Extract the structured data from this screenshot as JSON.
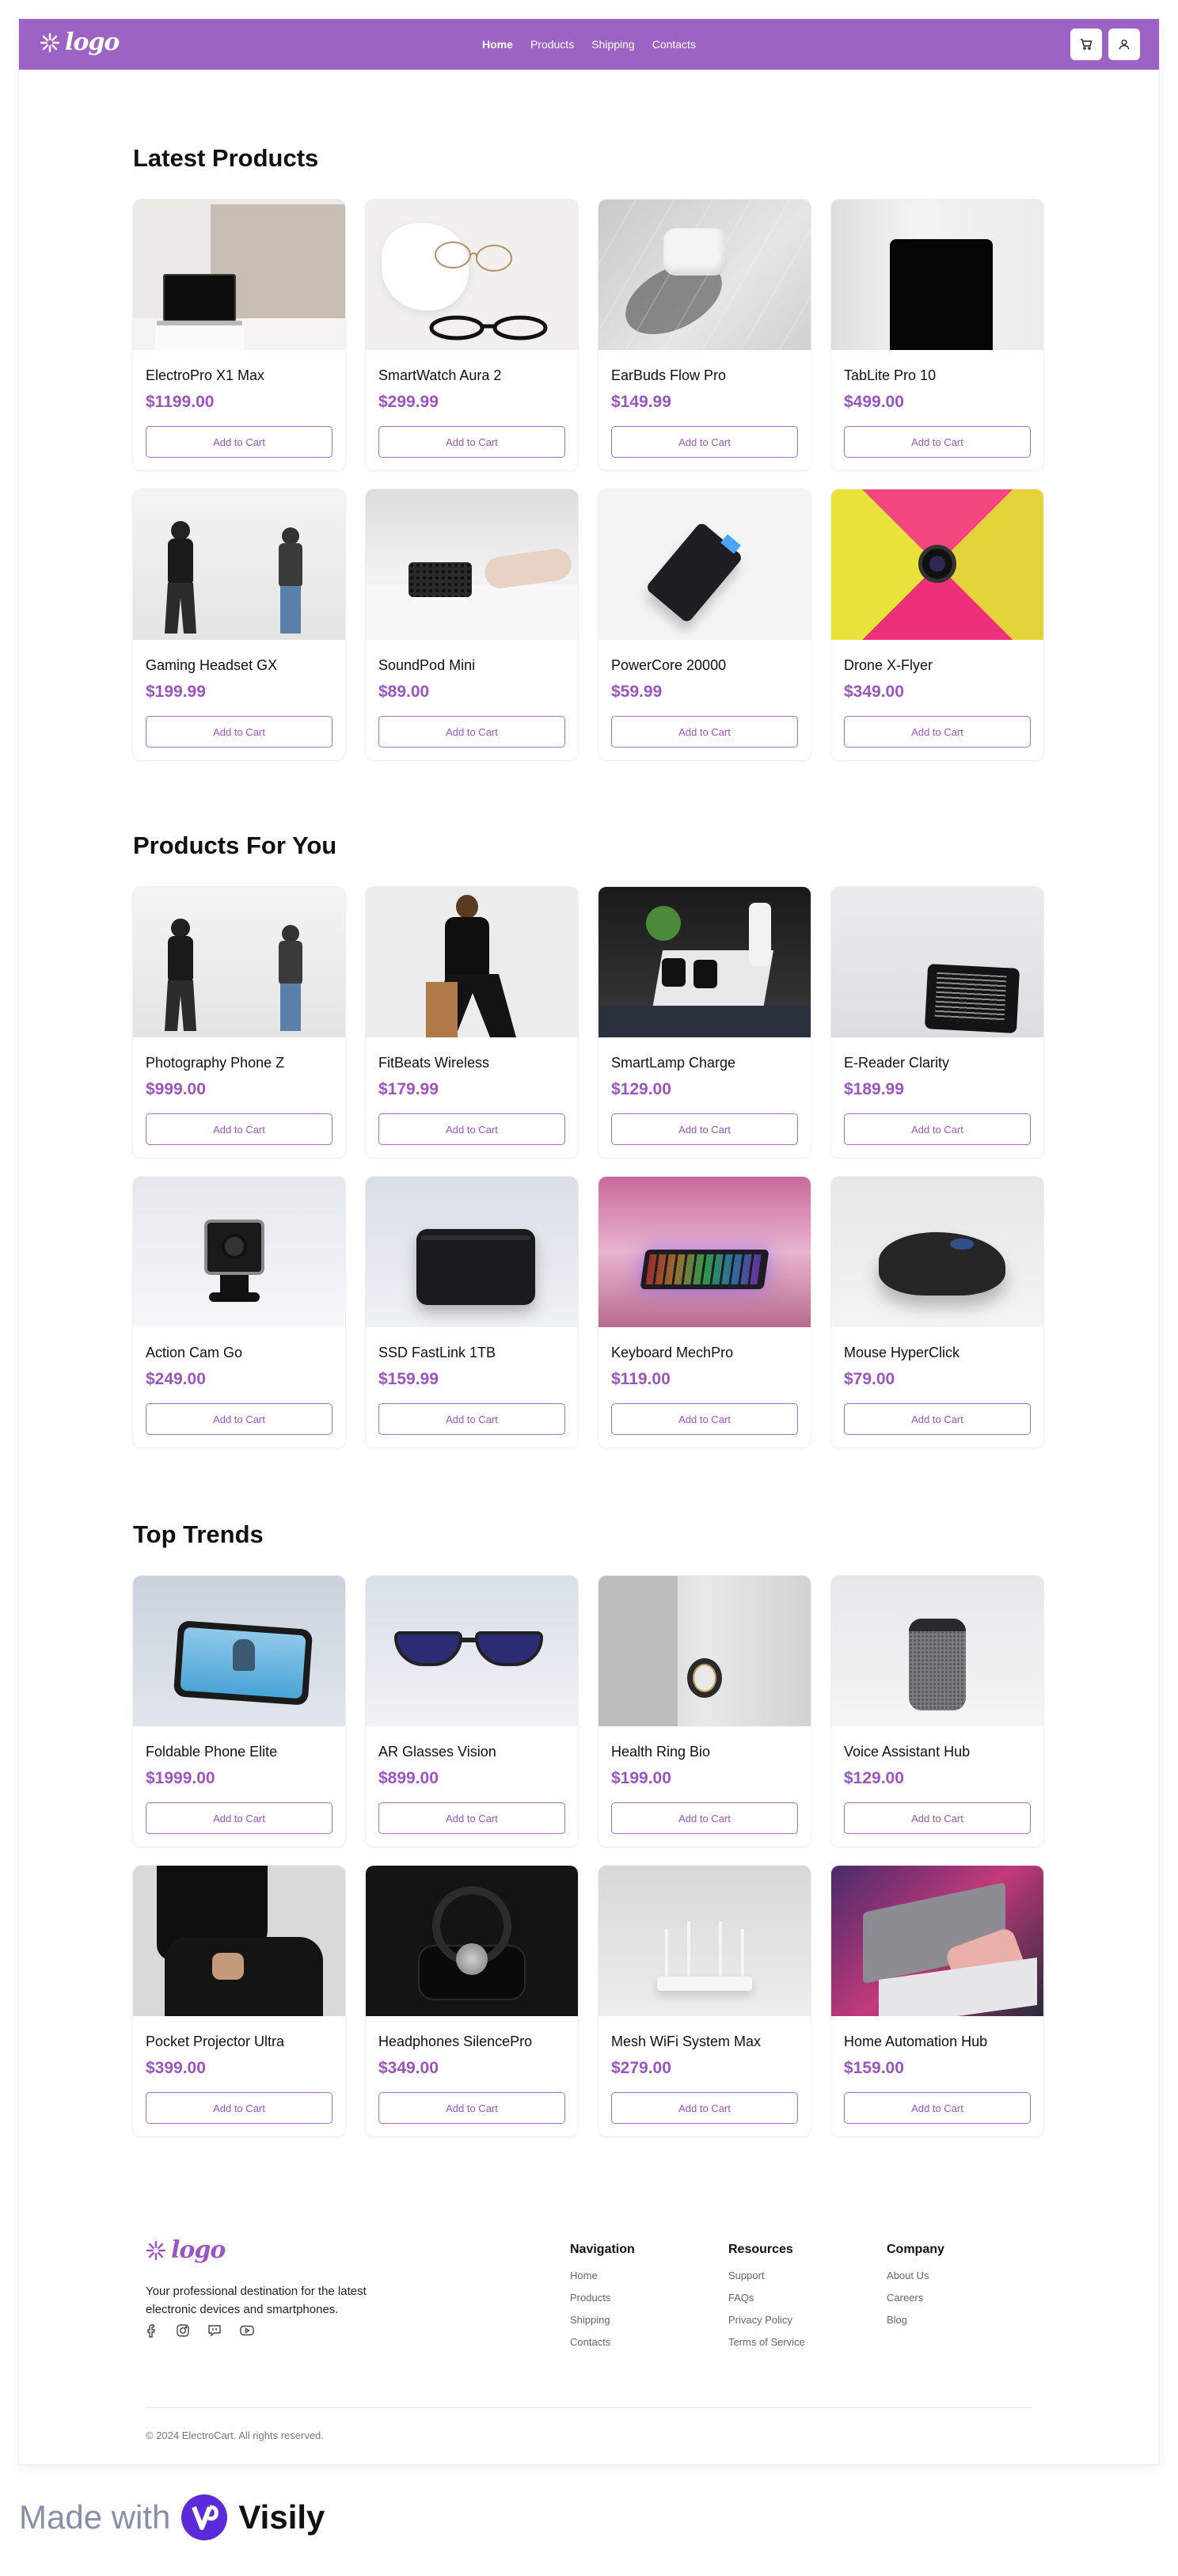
{
  "header": {
    "logo_text": "logo",
    "nav": [
      "Home",
      "Products",
      "Shipping",
      "Contacts"
    ],
    "active_nav": "Home",
    "cart_icon": "cart-icon",
    "user_icon": "user-icon",
    "bg_color": "#9c63c4"
  },
  "sections": [
    {
      "title": "Latest Products",
      "products": [
        {
          "name": "ElectroPro X1 Max",
          "price": "$1199.00",
          "button": "Add to Cart"
        },
        {
          "name": "SmartWatch Aura 2",
          "price": "$299.99",
          "button": "Add to Cart"
        },
        {
          "name": "EarBuds Flow Pro",
          "price": "$149.99",
          "button": "Add to Cart"
        },
        {
          "name": "TabLite Pro 10",
          "price": "$499.00",
          "button": "Add to Cart"
        },
        {
          "name": "Gaming Headset GX",
          "price": "$199.99",
          "button": "Add to Cart"
        },
        {
          "name": "SoundPod Mini",
          "price": "$89.00",
          "button": "Add to Cart"
        },
        {
          "name": "PowerCore 20000",
          "price": "$59.99",
          "button": "Add to Cart"
        },
        {
          "name": "Drone X-Flyer",
          "price": "$349.00",
          "button": "Add to Cart"
        }
      ]
    },
    {
      "title": "Products For You",
      "products": [
        {
          "name": "Photography Phone Z",
          "price": "$999.00",
          "button": "Add to Cart"
        },
        {
          "name": "FitBeats Wireless",
          "price": "$179.99",
          "button": "Add to Cart"
        },
        {
          "name": "SmartLamp Charge",
          "price": "$129.00",
          "button": "Add to Cart"
        },
        {
          "name": "E-Reader Clarity",
          "price": "$189.99",
          "button": "Add to Cart"
        },
        {
          "name": "Action Cam Go",
          "price": "$249.00",
          "button": "Add to Cart"
        },
        {
          "name": "SSD FastLink 1TB",
          "price": "$159.99",
          "button": "Add to Cart"
        },
        {
          "name": "Keyboard MechPro",
          "price": "$119.00",
          "button": "Add to Cart"
        },
        {
          "name": "Mouse HyperClick",
          "price": "$79.00",
          "button": "Add to Cart"
        }
      ]
    },
    {
      "title": "Top Trends",
      "products": [
        {
          "name": "Foldable Phone Elite",
          "price": "$1999.00",
          "button": "Add to Cart"
        },
        {
          "name": "AR Glasses Vision",
          "price": "$899.00",
          "button": "Add to Cart"
        },
        {
          "name": "Health Ring Bio",
          "price": "$199.00",
          "button": "Add to Cart"
        },
        {
          "name": "Voice Assistant Hub",
          "price": "$129.00",
          "button": "Add to Cart"
        },
        {
          "name": "Pocket Projector Ultra",
          "price": "$399.00",
          "button": "Add to Cart"
        },
        {
          "name": "Headphones SilencePro",
          "price": "$349.00",
          "button": "Add to Cart"
        },
        {
          "name": "Mesh WiFi System Max",
          "price": "$279.00",
          "button": "Add to Cart"
        },
        {
          "name": "Home Automation Hub",
          "price": "$159.00",
          "button": "Add to Cart"
        }
      ]
    }
  ],
  "footer": {
    "logo_text": "logo",
    "description": "Your professional destination for the latest electronic devices and smartphones.",
    "social_icons": [
      "facebook-icon",
      "instagram-icon",
      "chat-icon",
      "youtube-icon"
    ],
    "columns": [
      {
        "title": "Navigation",
        "links": [
          "Home",
          "Products",
          "Shipping",
          "Contacts"
        ]
      },
      {
        "title": "Resources",
        "links": [
          "Support",
          "FAQs",
          "Privacy Policy",
          "Terms of Service"
        ]
      },
      {
        "title": "Company",
        "links": [
          "About Us",
          "Careers",
          "Blog"
        ]
      }
    ],
    "copyright": "© 2024 ElectroCart. All rights reserved."
  },
  "watermark": {
    "text": "Made with",
    "brand": "Visily"
  },
  "colors": {
    "accent": "#9c55c0",
    "header": "#9c63c4"
  }
}
